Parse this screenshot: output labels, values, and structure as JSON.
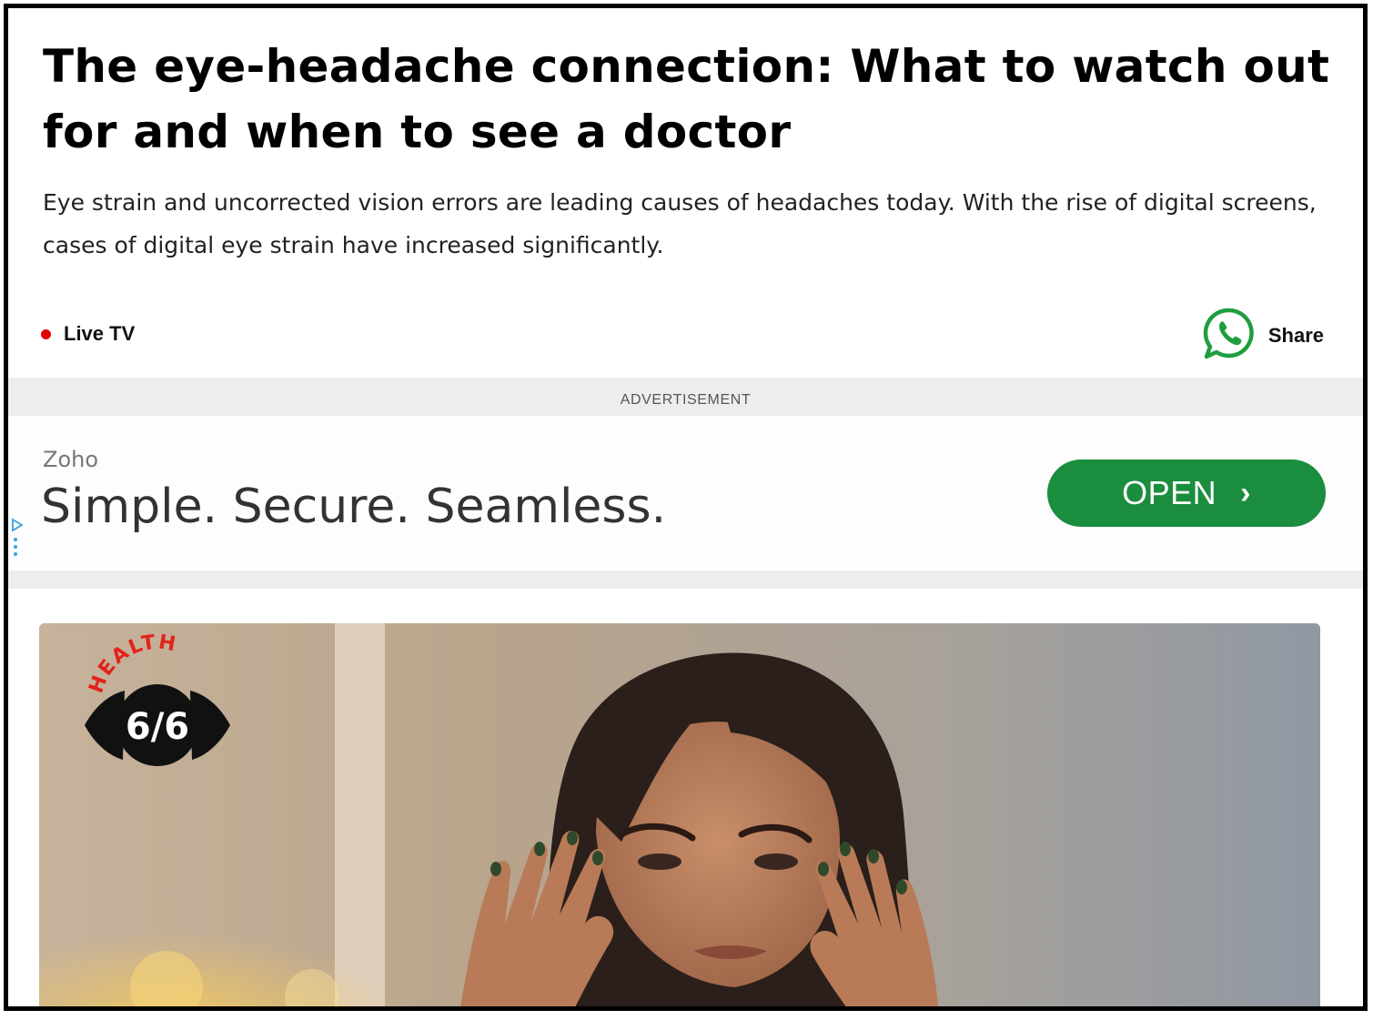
{
  "article": {
    "headline": "The eye-headache connection: What to watch out for and when to see a doctor",
    "summary": "Eye strain and uncorrected vision errors are leading causes of headaches today. With the rise of digital screens, cases of digital eye strain have increased significantly."
  },
  "meta": {
    "live_tv_label": "Live TV",
    "share_label": "Share",
    "share_icon": "whatsapp-icon",
    "live_dot_color": "#e00000",
    "whatsapp_color": "#1f9d3f"
  },
  "advertisement": {
    "header": "ADVERTISEMENT",
    "brand": "Zoho",
    "tagline": "Simple. Secure. Seamless.",
    "cta_label": "OPEN",
    "cta_icon": "chevron-right-icon",
    "cta_color": "#1a8d3e",
    "adchoices_icon": "adchoices-icon"
  },
  "hero": {
    "logo_arc_text": "HEALTH",
    "logo_numeral": "6/6",
    "logo_arc_color": "#e2231a"
  }
}
